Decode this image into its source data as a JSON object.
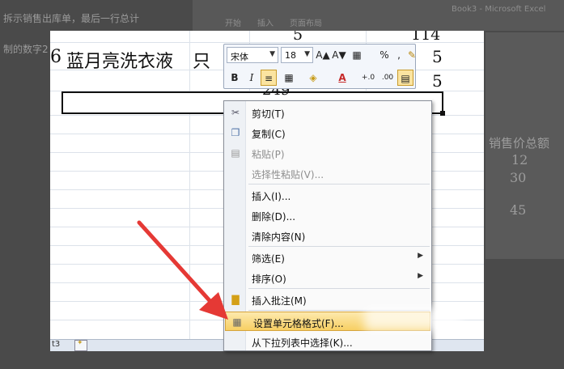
{
  "background": {
    "left_lines": [
      "拆示销售出库单，最后一行总计",
      "制的数字2"
    ],
    "top_bar": [
      "开始",
      "插入",
      "页面布局",
      "Book3 - Microsoft Excel"
    ],
    "right_header": "销售价总额",
    "right_values": [
      "12",
      "30",
      "45"
    ]
  },
  "sheet": {
    "rows": [
      {
        "num": "5",
        "price": "114"
      },
      {
        "num": "6",
        "name": "蓝月亮洗衣液",
        "unit": "只",
        "price": "5"
      },
      {
        "price": "5"
      }
    ],
    "total_partial": "249",
    "tab_label": "t3"
  },
  "mini_toolbar": {
    "font_name": "宋体",
    "font_size": "18",
    "buttons": [
      "A▲",
      "A▼",
      "▦",
      "%",
      ",",
      "✎",
      "B",
      "I",
      "≡",
      "▦",
      "◈",
      "A",
      "+.0",
      ".00",
      "▤"
    ]
  },
  "context_menu": {
    "items": [
      {
        "label": "剪切(T)",
        "icon": "scissors-icon",
        "glyph": "✂",
        "disabled": false
      },
      {
        "label": "复制(C)",
        "icon": "copy-icon",
        "glyph": "❐",
        "disabled": false
      },
      {
        "label": "粘贴(P)",
        "icon": "paste-icon",
        "glyph": "▤",
        "disabled": true
      },
      {
        "label": "选择性粘贴(V)...",
        "icon": "",
        "glyph": "",
        "disabled": true
      },
      {
        "label": "插入(I)...",
        "icon": "",
        "glyph": "",
        "disabled": false
      },
      {
        "label": "删除(D)...",
        "icon": "",
        "glyph": "",
        "disabled": false
      },
      {
        "label": "清除内容(N)",
        "icon": "",
        "glyph": "",
        "disabled": false
      },
      {
        "label": "筛选(E)",
        "icon": "",
        "glyph": "",
        "disabled": false,
        "submenu": true
      },
      {
        "label": "排序(O)",
        "icon": "",
        "glyph": "",
        "disabled": false,
        "submenu": true
      },
      {
        "label": "插入批注(M)",
        "icon": "comment-icon",
        "glyph": "▇",
        "disabled": false
      },
      {
        "label": "设置单元格格式(F)...",
        "icon": "format-cells-icon",
        "glyph": "▦",
        "disabled": false,
        "highlight": true
      },
      {
        "label": "从下拉列表中选择(K)...",
        "icon": "",
        "glyph": "",
        "disabled": false
      }
    ]
  },
  "colors": {
    "arrow": "#e53935",
    "highlight": "#f7cf63"
  }
}
